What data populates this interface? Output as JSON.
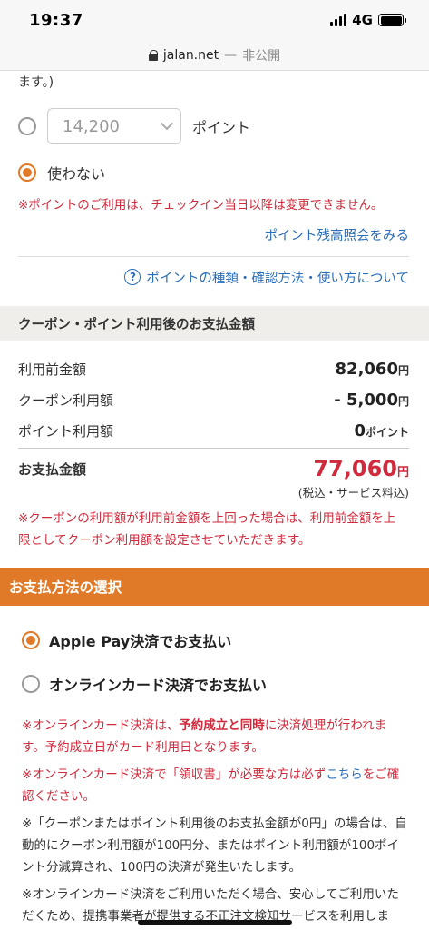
{
  "status_bar": {
    "time": "19:37",
    "network": "4G"
  },
  "url_bar": {
    "domain": "jalan.net",
    "separator": "—",
    "note": "非公開"
  },
  "points": {
    "cut_text": "ます。)",
    "select_value": "14,200",
    "unit": "ポイント",
    "no_use_label": "使わない",
    "warning": "※ポイントのご利用は、チェックイン当日以降は変更できません。",
    "balance_link": "ポイント残高照会をみる",
    "help_icon_text": "?",
    "help_link": "ポイントの種類・確認方法・使い方について"
  },
  "summary": {
    "heading": "クーポン・ポイント利用後のお支払金額",
    "rows": [
      {
        "label": "利用前金額",
        "value": "82,060",
        "unit": "円"
      },
      {
        "label": "クーポン利用額",
        "value": "- 5,000",
        "unit": "円"
      },
      {
        "label": "ポイント利用額",
        "value": "0",
        "unit": "ポイント"
      }
    ],
    "total_label": "お支払金額",
    "total_value": "77,060",
    "total_unit": "円",
    "total_note": "(税込・サービス料込)",
    "warning": "※クーポンの利用額が利用前金額を上回った場合は、利用前金額を上限としてクーポン利用額を設定させていただきます。"
  },
  "payment": {
    "heading": "お支払方法の選択",
    "options": [
      {
        "label": "Apple Pay決済でお支払い",
        "selected": true
      },
      {
        "label": "オンラインカード決済でお支払い",
        "selected": false
      }
    ],
    "notes": {
      "n1_a": "※オンラインカード決済は、",
      "n1_b": "予約成立と同時",
      "n1_c": "に決済処理が行われます。予約成立日がカード利用日となります。",
      "n2_a": "※オンラインカード決済で「領収書」が必要な方は必ず",
      "n2_link": "こちら",
      "n2_b": "をご確認ください。",
      "n3": "※「クーポンまたはポイント利用後のお支払金額が0円」の場合は、自動的にクーポン利用額が100円分、またはポイント利用額が100ポイント分減算され、100円の決済が発生いたします。",
      "n4": "※オンラインカード決済をご利用いただく場合、安心してご利用いただくため、提携事業者が提供する不正注文検知サービスを利用します。"
    }
  },
  "colors": {
    "accent": "#e07a28",
    "warning": "#d02a3c",
    "link": "#2a6ebb"
  }
}
